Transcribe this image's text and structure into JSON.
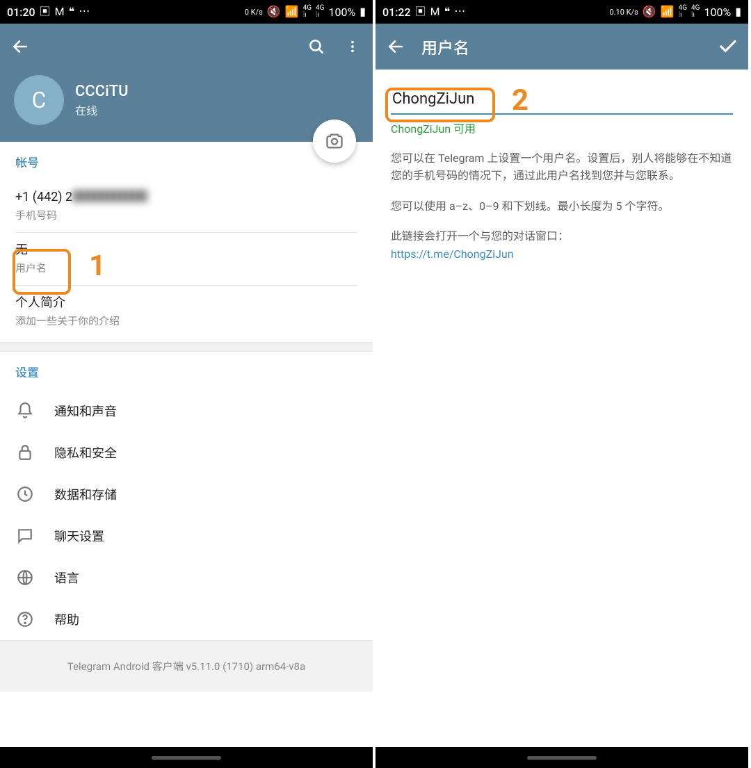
{
  "annotations": {
    "one": "1",
    "two": "2"
  },
  "left": {
    "status": {
      "time": "01:20",
      "net": "0 K/s",
      "battery": "100%"
    },
    "profile": {
      "avatar_letter": "C",
      "name": "CCCiTU",
      "status": "在线"
    },
    "account": {
      "section_title": "帐号",
      "phone_value": "+1 (442) 2",
      "phone_label": "手机号码",
      "username_value": "无",
      "username_label": "用户名",
      "bio_value": "个人简介",
      "bio_label": "添加一些关于你的介绍"
    },
    "settings": {
      "section_title": "设置",
      "items": [
        {
          "label": "通知和声音",
          "icon": "bell"
        },
        {
          "label": "隐私和安全",
          "icon": "lock"
        },
        {
          "label": "数据和存储",
          "icon": "clock"
        },
        {
          "label": "聊天设置",
          "icon": "chat"
        },
        {
          "label": "语言",
          "icon": "globe"
        },
        {
          "label": "帮助",
          "icon": "help"
        }
      ]
    },
    "version": "Telegram Android 客户端 v5.11.0 (1710) arm64-v8a"
  },
  "right": {
    "status": {
      "time": "01:22",
      "net": "0.10 K/s",
      "battery": "100%"
    },
    "title": "用户名",
    "input_value": "ChongZiJun",
    "available_text": "ChongZiJun 可用",
    "desc1": "您可以在 Telegram 上设置一个用户名。设置后，别人将能够在不知道您的手机号码的情况下，通过此用户名找到您并与您联系。",
    "desc2": "您可以使用 a–z、0–9 和下划线。最小长度为 5 个字符。",
    "desc3": "此链接会打开一个与您的对话窗口：",
    "link": "https://t.me/ChongZiJun"
  }
}
